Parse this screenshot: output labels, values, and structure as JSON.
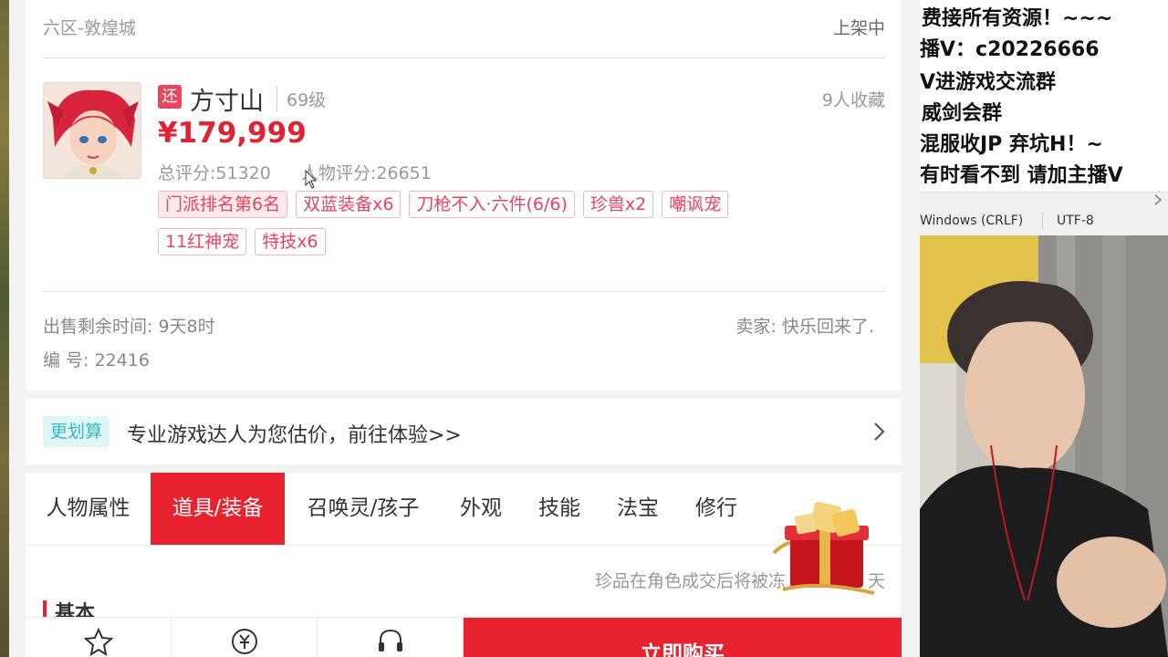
{
  "listing": {
    "server": "六区-敦煌城",
    "status": "上架中",
    "return_badge": "还",
    "school": "方寸山",
    "level": "69级",
    "favorites": "9人收藏",
    "price": "¥179,999",
    "total_score": "总评分:51320",
    "char_score": "人物评分:26651",
    "tags": [
      "门派排名第6名",
      "双蓝装备x6",
      "刀枪不入·六件(6/6)",
      "珍兽x2",
      "嘲讽宠",
      "11红神宠",
      "特技x6"
    ],
    "sale_time": "出售剩余时间: 9天8时",
    "seller": "卖家: 快乐回来了.",
    "item_id": "编 号: 22416"
  },
  "appraise": {
    "tag": "更划算",
    "text": "专业游戏达人为您估价，前往体验>>"
  },
  "tabs": [
    "人物属性",
    "道具/装备",
    "召唤灵/孩子",
    "外观",
    "技能",
    "法宝",
    "修行"
  ],
  "active_tab": "道具/装备",
  "notice": "珍品在角色成交后将被冻",
  "notice_tail": "天",
  "section_title": "基本",
  "bottom": {
    "buy_label": "立即购买"
  },
  "overlay": {
    "lines": [
      "费接所有资源！~~~",
      "播V：c20226666",
      "V进游戏交流群",
      "威剑会群",
      "混服收JP    弃坑H！~",
      "有时看不到 请加主播V"
    ],
    "line_endings": "Windows (CRLF)",
    "encoding": "UTF-8"
  },
  "colors": {
    "accent": "#e8232f",
    "tag": "#e8455f",
    "appraise": "#3bb8be"
  }
}
